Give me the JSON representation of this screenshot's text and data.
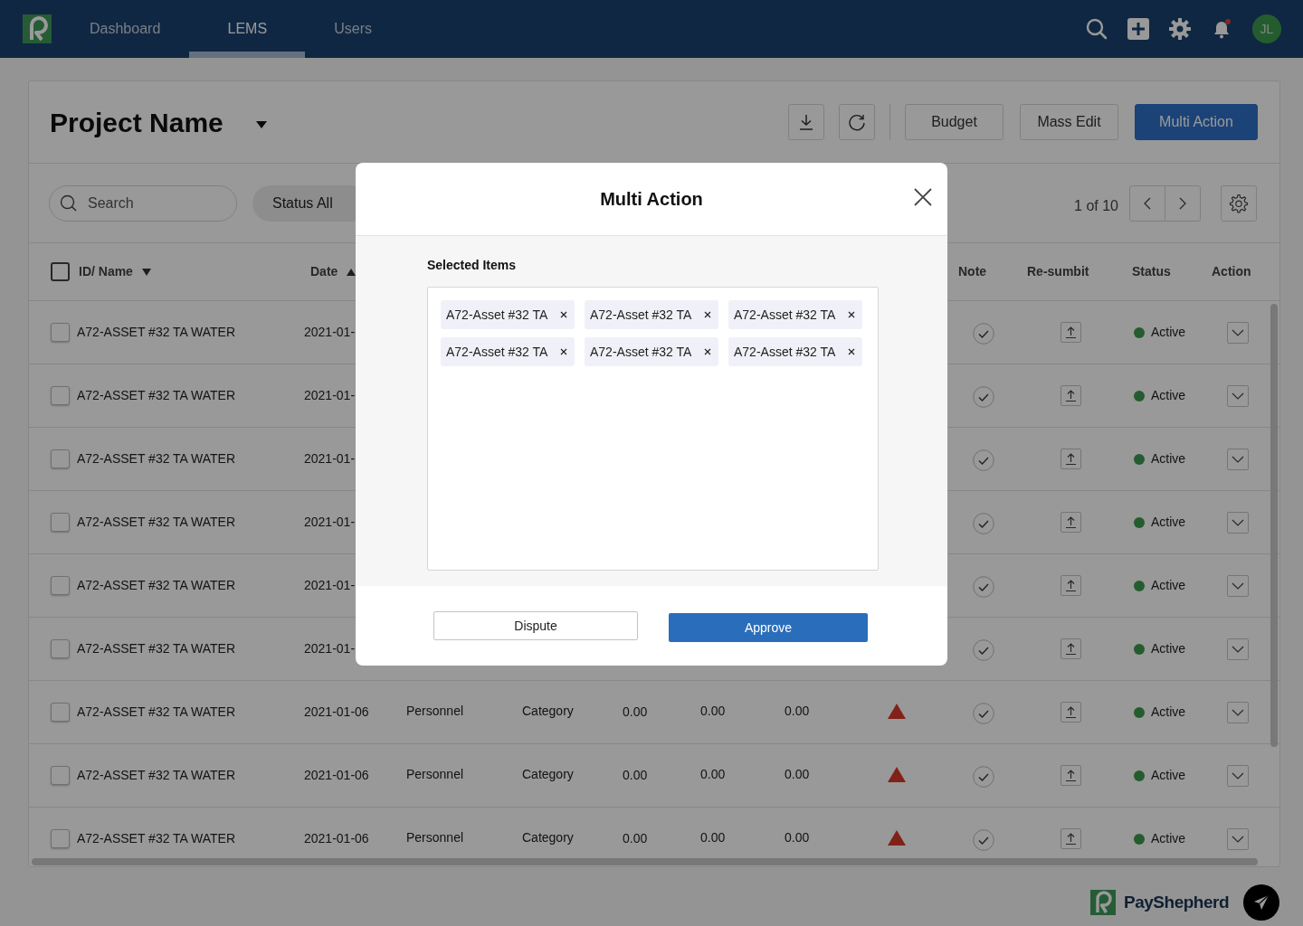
{
  "nav": {
    "tabs": [
      {
        "label": "Dashboard",
        "selected": false
      },
      {
        "label": "LEMS",
        "selected": true
      },
      {
        "label": "Users",
        "selected": false
      }
    ],
    "notifications_unread": true,
    "avatar_initials": "JL"
  },
  "project": {
    "title": "Project Name",
    "buttons": [
      {
        "label": "Budget",
        "kind": "secondary"
      },
      {
        "label": "Mass Edit",
        "kind": "secondary"
      },
      {
        "label": "Multi Action",
        "kind": "primary"
      }
    ]
  },
  "filters": {
    "search": {
      "placeholder": "Search"
    },
    "status": "Status All",
    "pagination": "1 of 10"
  },
  "table": {
    "select_all_checked": false,
    "columns": [
      {
        "label": "ID/ Name",
        "sorted_ascending": false
      },
      {
        "label": "Date",
        "sorted_ascending": true
      },
      {
        "label": "Note"
      },
      {
        "label": "Re-sumbit"
      },
      {
        "label": "Status"
      },
      {
        "label": "Action"
      }
    ],
    "rows": [
      {
        "checked": false,
        "name": "A72-ASSET #32 TA WATER",
        "date": "2021-01-",
        "status": "Active"
      },
      {
        "checked": false,
        "name": "A72-ASSET #32 TA WATER",
        "date": "2021-01-",
        "status": "Active"
      },
      {
        "checked": false,
        "name": "A72-ASSET #32 TA WATER",
        "date": "2021-01-",
        "status": "Active"
      },
      {
        "checked": false,
        "name": "A72-ASSET #32 TA WATER",
        "date": "2021-01-",
        "status": "Active"
      },
      {
        "checked": false,
        "name": "A72-ASSET #32 TA WATER",
        "date": "2021-01-",
        "status": "Active"
      },
      {
        "checked": false,
        "name": "A72-ASSET #32 TA WATER",
        "date": "2021-01-",
        "status": "Active"
      },
      {
        "checked": false,
        "name": "A72-ASSET #32 TA WATER",
        "date": "2021-01-06",
        "type": "Personnel",
        "category": "Category",
        "values": [
          "0.00",
          "0.00",
          "0.00"
        ],
        "flagged": true,
        "status": "Active"
      },
      {
        "checked": false,
        "name": "A72-ASSET #32 TA WATER",
        "date": "2021-01-06",
        "type": "Personnel",
        "category": "Category",
        "values": [
          "0.00",
          "0.00",
          "0.00"
        ],
        "flagged": true,
        "status": "Active"
      },
      {
        "checked": false,
        "name": "A72-ASSET #32 TA WATER",
        "date": "2021-01-06",
        "type": "Personnel",
        "category": "Category",
        "values": [
          "0.00",
          "0.00",
          "0.00"
        ],
        "flagged": true,
        "status": "Active"
      }
    ]
  },
  "modal": {
    "title": "Multi Action",
    "label": "Selected Items",
    "items": [
      "A72-Asset #32 TA",
      "A72-Asset #32 TA",
      "A72-Asset #32 TA",
      "A72-Asset #32 TA",
      "A72-Asset #32 TA",
      "A72-Asset #32 TA"
    ],
    "buttons": [
      {
        "label": "Dispute",
        "kind": "secondary"
      },
      {
        "label": "Approve",
        "kind": "primary"
      }
    ]
  },
  "footer": {
    "brand": "PayShepherd"
  }
}
